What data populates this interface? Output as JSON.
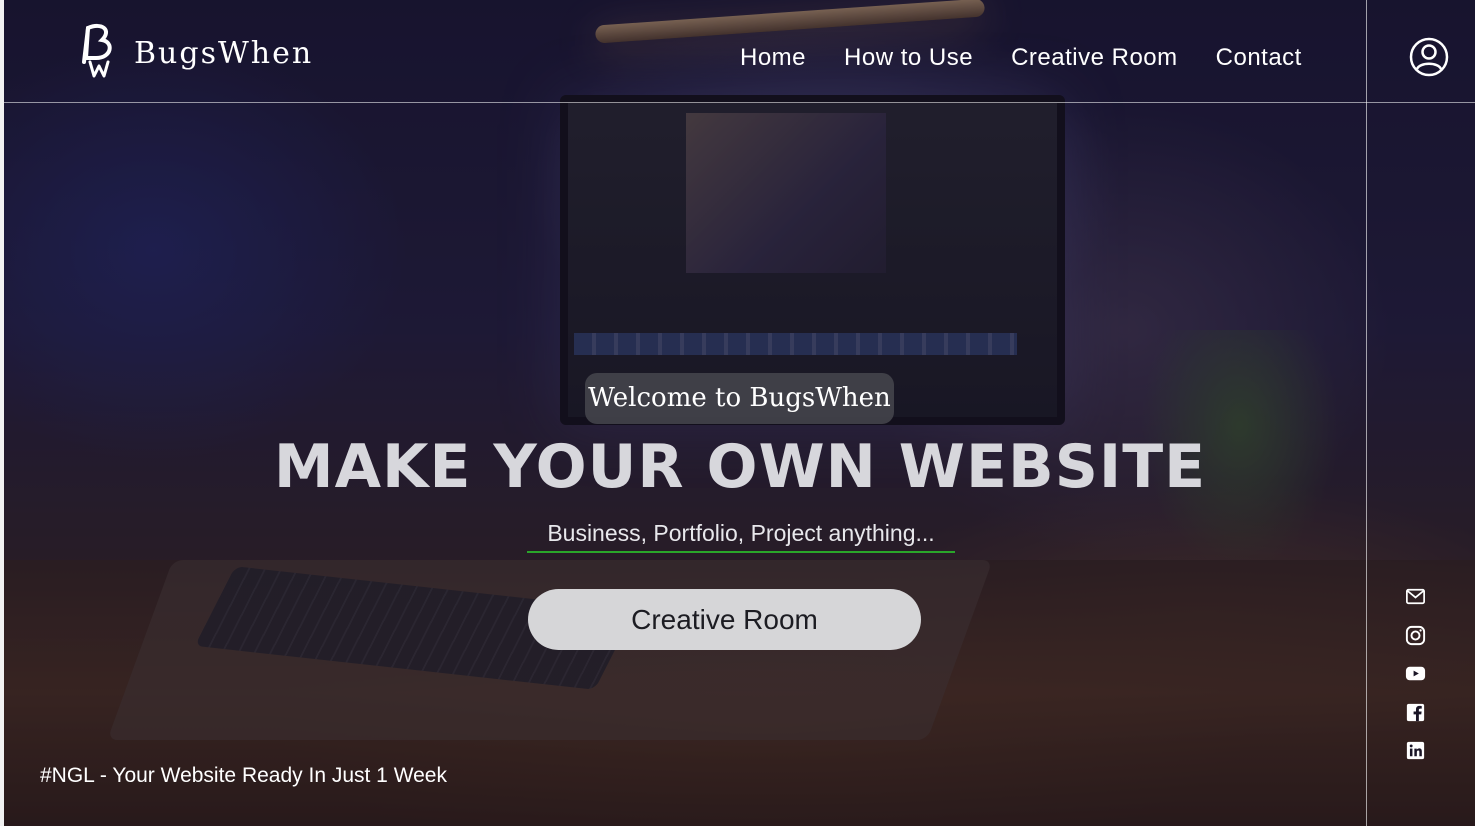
{
  "header": {
    "brand": "BugsWhen",
    "nav": [
      {
        "label": "Home"
      },
      {
        "label": "How to Use"
      },
      {
        "label": "Creative Room"
      },
      {
        "label": "Contact"
      }
    ],
    "account_icon": "user-circle-icon"
  },
  "hero": {
    "welcome": "Welcome to BugsWhen",
    "headline": "MAKE YOUR OWN WEBSITE",
    "subheadline": "Business, Portfolio, Project anything...",
    "cta_label": "Creative Room"
  },
  "footer": {
    "tagline": "#NGL - Your Website Ready In Just 1 Week"
  },
  "social": [
    "mail-icon",
    "instagram-icon",
    "youtube-icon",
    "facebook-icon",
    "linkedin-icon"
  ],
  "colors": {
    "text": "#ffffff",
    "headline": "#d7d7dc",
    "cta_bg": "#d6d6d8",
    "underline_accent": "#2aa52a"
  }
}
